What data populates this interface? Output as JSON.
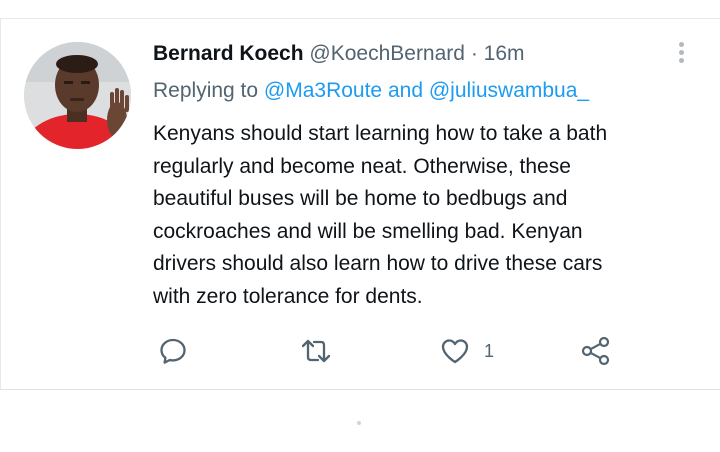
{
  "tweet": {
    "author_name": "Bernard Koech",
    "author_handle": "@KoechBernard",
    "separator": "·",
    "timestamp": "16m",
    "reply_prefix": "Replying to",
    "reply_mention_1": "@Ma3Route",
    "reply_conjunction": "and",
    "reply_mention_2": "@juliuswambua_",
    "body_lines": [
      "Kenyans should start learning how to take a bath",
      "regularly and become neat. Otherwise, these",
      "beautiful buses will be home to bedbugs and",
      "cockroaches and will be smelling bad. Kenyan",
      "drivers should also learn how to drive these cars",
      "with zero tolerance for dents."
    ],
    "like_count": "1"
  },
  "icons": {
    "reply": "reply-icon",
    "retweet": "retweet-icon",
    "like": "heart-icon",
    "share": "share-icon",
    "more": "more-vertical-icon"
  },
  "colors": {
    "mention": "#1d9bf0",
    "secondary_text": "#536471",
    "primary_text": "#0f1419",
    "icon": "#536471"
  }
}
